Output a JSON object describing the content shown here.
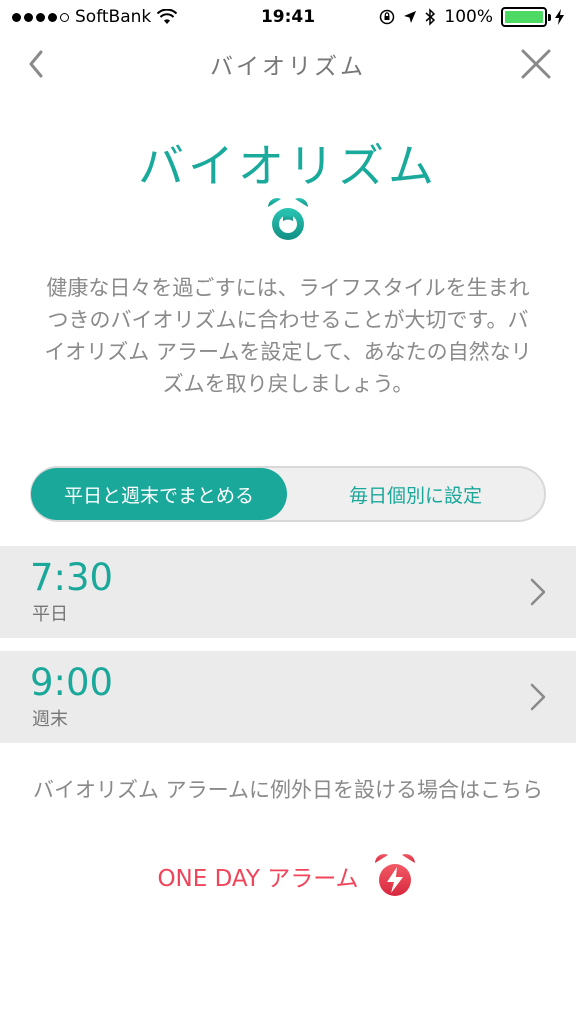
{
  "status_bar": {
    "carrier": "SoftBank",
    "time": "19:41",
    "battery": "100%",
    "battery_level": 1.0
  },
  "nav": {
    "title": "バイオリズム",
    "back_icon": "chevron-left-icon",
    "close_icon": "close-icon"
  },
  "hero": {
    "title": "バイオリズム",
    "icon": "alarm-clock-icon"
  },
  "description": "健康な日々を過ごすには、ライフスタイルを生まれつきのバイオリズムに合わせることが大切です。バイオリズム アラームを設定して、あなたの自然なリズムを取り戻しましょう。",
  "mode_toggle": {
    "options": [
      "平日と週末でまとめる",
      "毎日個別に設定"
    ],
    "selected": "平日と週末でまとめる"
  },
  "alarms": [
    {
      "time": "7:30",
      "label": "平日"
    },
    {
      "time": "9:00",
      "label": "週末"
    }
  ],
  "exception_text": "バイオリズム アラームに例外日を設ける場合はこちら",
  "oneday": {
    "label": "ONE DAY アラーム",
    "icon": "one-day-alarm-icon"
  },
  "colors": {
    "accent": "#1aa89b",
    "oneday_red": "#f0445a",
    "row_bg": "#ebebeb",
    "battery_green": "#4cd964"
  }
}
